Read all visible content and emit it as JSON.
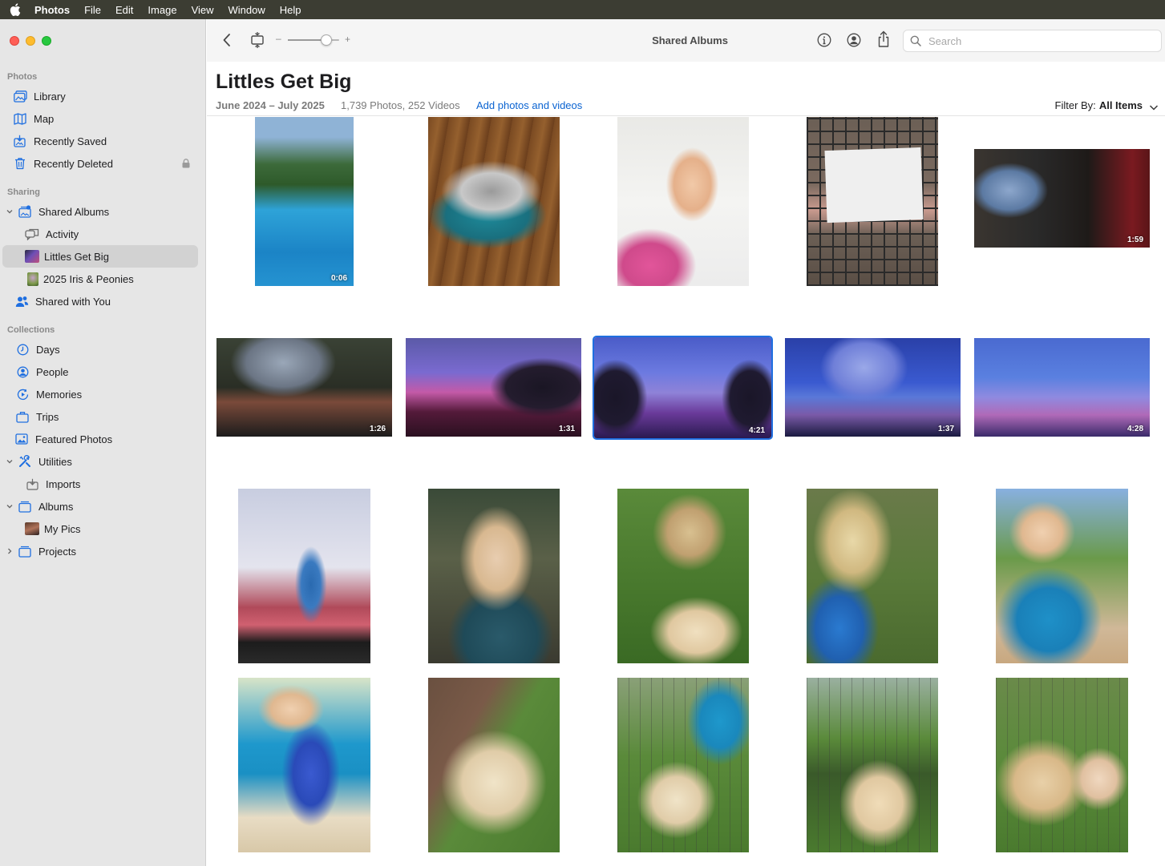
{
  "menubar": {
    "app_name": "Photos",
    "items": [
      "File",
      "Edit",
      "Image",
      "View",
      "Window",
      "Help"
    ]
  },
  "sidebar": {
    "photos_section": "Photos",
    "library": "Library",
    "map": "Map",
    "recently_saved": "Recently Saved",
    "recently_deleted": "Recently Deleted",
    "sharing_section": "Sharing",
    "shared_albums": "Shared Albums",
    "activity": "Activity",
    "littles_get_big": "Littles Get Big",
    "iris_peonies": "2025 Iris & Peonies",
    "shared_with_you": "Shared with You",
    "collections_section": "Collections",
    "days": "Days",
    "people": "People",
    "memories": "Memories",
    "trips": "Trips",
    "featured_photos": "Featured Photos",
    "utilities": "Utilities",
    "imports": "Imports",
    "albums": "Albums",
    "my_pics": "My Pics",
    "projects": "Projects"
  },
  "toolbar": {
    "title": "Shared Albums",
    "zoom_minus": "–",
    "zoom_plus": "+",
    "zoom_level": 0.75,
    "search_placeholder": "Search"
  },
  "album": {
    "title": "Littles Get Big",
    "dates": "June 2024 – July 2025",
    "count": "1,739 Photos, 252 Videos",
    "add_link": "Add photos and videos",
    "filter_label": "Filter By:",
    "filter_value": "All Items"
  },
  "grid": {
    "durations": [
      "0:06",
      "1:59",
      "1:26",
      "1:31",
      "4:21",
      "1:37",
      "4:28"
    ]
  }
}
